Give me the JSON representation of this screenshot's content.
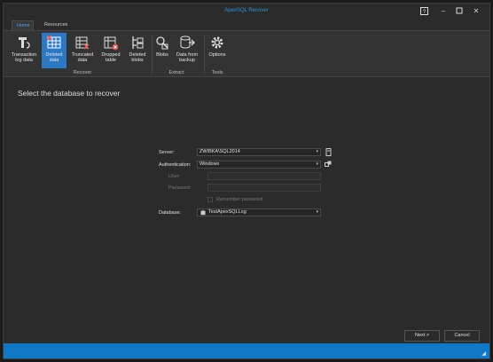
{
  "window": {
    "title": "ApexSQL Recover"
  },
  "tabs": {
    "home": "Home",
    "resources": "Resources"
  },
  "ribbon": {
    "buttons": {
      "transaction_log": "Transaction log data",
      "deleted_data": "Deleted data",
      "truncated_data": "Truncated data",
      "dropped_table": "Dropped table",
      "deleted_blobs": "Deleted blobs",
      "blobs": "Blobs",
      "data_from_backup": "Data from backup",
      "options": "Options"
    },
    "groups": {
      "recover": "Recover",
      "extract": "Extract",
      "tools": "Tools"
    }
  },
  "main": {
    "heading": "Select the database to recover"
  },
  "form": {
    "server_label": "Server:",
    "server_value": "ZWIBKA\\SQL2014",
    "auth_label": "Authentication:",
    "auth_value": "Windows",
    "user_label": "User:",
    "password_label": "Password:",
    "remember_label": "Remember password",
    "database_label": "Database:",
    "database_value": "TestApexSQLLog"
  },
  "footer": {
    "next": "Next >",
    "cancel": "Cancel"
  },
  "colors": {
    "accent": "#2b78c4",
    "statusbar": "#0f79c7",
    "title": "#2f8fd8"
  }
}
